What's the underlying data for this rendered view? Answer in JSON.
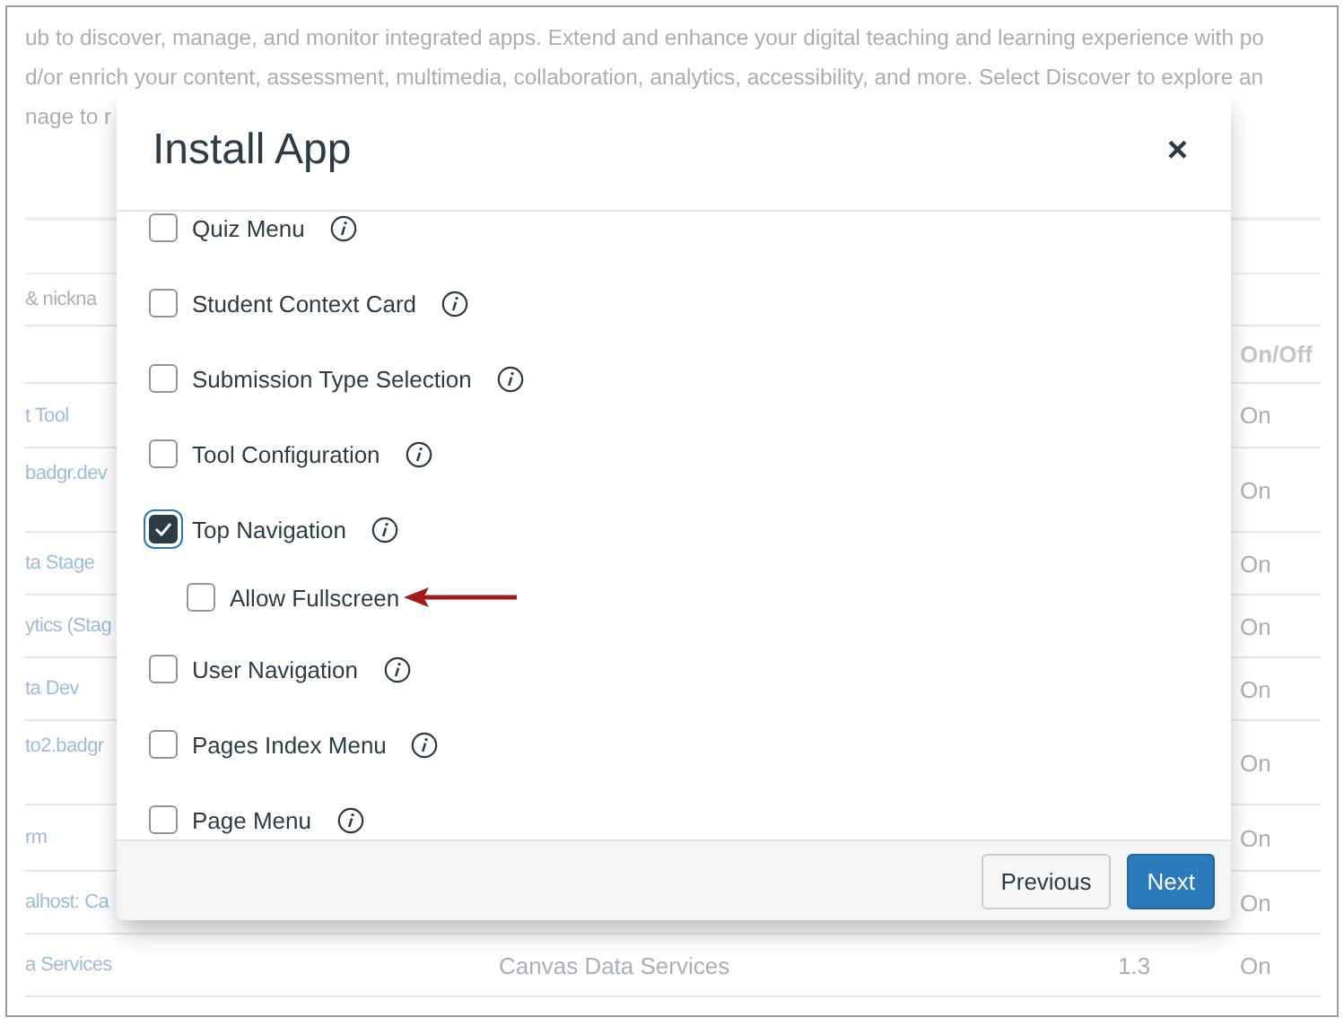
{
  "page": {
    "description_lines": [
      "ub to discover, manage, and monitor integrated apps. Extend and enhance your digital teaching and learning experience with po",
      "d/or enrich your content, assessment, multimedia, collaboration, analytics, accessibility, and more. Select Discover to explore an",
      "nage to r"
    ],
    "search_hint": "& nickna",
    "table": {
      "status_header": "On/Off",
      "rows": [
        {
          "name": "t Tool",
          "status": "On"
        },
        {
          "name": "badgr.dev",
          "status": "On"
        },
        {
          "name": "ta Stage",
          "status": "On"
        },
        {
          "name": "ytics (Stag",
          "status": "On"
        },
        {
          "name": "ta Dev",
          "status": "On"
        },
        {
          "name": "to2.badgr",
          "status": "On"
        },
        {
          "name": "rm",
          "status": "On"
        },
        {
          "name": "alhost: Ca",
          "status": "On"
        },
        {
          "name": "a Services",
          "app": "Canvas Data Services",
          "version": "1.3",
          "status": "On"
        }
      ]
    }
  },
  "dialog": {
    "title": "Install App",
    "close": "×",
    "placements": [
      {
        "label": "Quiz Menu",
        "checked": false
      },
      {
        "label": "Student Context Card",
        "checked": false
      },
      {
        "label": "Submission Type Selection",
        "checked": false
      },
      {
        "label": "Tool Configuration",
        "checked": false
      },
      {
        "label": "Top Navigation",
        "checked": true,
        "children": [
          {
            "label": "Allow Fullscreen",
            "checked": false,
            "highlighted": true
          }
        ]
      },
      {
        "label": "User Navigation",
        "checked": false
      },
      {
        "label": "Pages Index Menu",
        "checked": false
      },
      {
        "label": "Page Menu",
        "checked": false
      }
    ],
    "buttons": [
      {
        "label": "Previous",
        "kind": "secondary"
      },
      {
        "label": "Next",
        "kind": "primary"
      }
    ]
  }
}
